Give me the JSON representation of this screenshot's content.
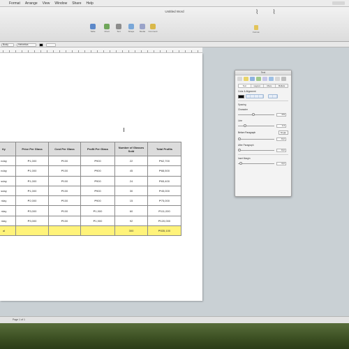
{
  "menubar": {
    "items": [
      "",
      "Format",
      "Arrange",
      "View",
      "Window",
      "Share",
      "Help"
    ]
  },
  "window": {
    "title": "Untitled Word"
  },
  "toolbar": {
    "tools": [
      {
        "label": "Table",
        "icon": "table-icon",
        "color": "#5c88c9"
      },
      {
        "label": "Chart",
        "icon": "chart-icon",
        "color": "#6fa65a"
      },
      {
        "label": "Text",
        "icon": "text-icon",
        "color": "#8c8c8c"
      },
      {
        "label": "Shape",
        "icon": "shape-icon",
        "color": "#7aa7d8"
      },
      {
        "label": "Media",
        "icon": "media-icon",
        "color": "#9aa3c9"
      },
      {
        "label": "Comment",
        "icon": "comment-icon",
        "color": "#d9b84a"
      }
    ],
    "right_tool_label": "Format"
  },
  "formatbar": {
    "style_value": "Body",
    "font_value": "Helvetica"
  },
  "table": {
    "headers": [
      "ity",
      "Price Per Glass",
      "Cost Per Glass",
      "Profit Per Glass",
      "Number of Glasses Sold",
      "Total Profits"
    ],
    "rows": [
      [
        "nday",
        "₱1,000",
        "₱100",
        "₱900",
        "22",
        "₱62,700"
      ],
      [
        "nday",
        "₱1,000",
        "₱100",
        "₱900",
        "45",
        "₱88,500"
      ],
      [
        "sday",
        "₱1,000",
        "₱100",
        "₱900",
        "24",
        "₱65,400"
      ],
      [
        "sday",
        "₱1,000",
        "₱100",
        "₱900",
        "30",
        "₱45,000"
      ],
      [
        "rday",
        "₱2,000",
        "₱100",
        "₱900",
        "15",
        "₱75,000"
      ],
      [
        "rday",
        "₱3,000",
        "₱100",
        "₱1,900",
        "60",
        "₱111,000"
      ],
      [
        "rday",
        "₱3,000",
        "₱100",
        "₱1,900",
        "92",
        "₱120,000"
      ]
    ],
    "total_row": [
      "al",
      "",
      "",
      "",
      "300",
      "₱535,100"
    ],
    "colors": {
      "header_bg": "#dcdcdc",
      "total_bg": "#fff37a"
    }
  },
  "inspector": {
    "title": "Text",
    "tabs": [
      "Text",
      "Layout",
      "More",
      "Bullets"
    ],
    "section_color_alignment": "Color & Alignment",
    "section_spacing": "Spacing",
    "label_character": "Character",
    "label_line": "Line",
    "label_before_paragraph": "Before Paragraph",
    "label_after_paragraph": "After Paragraph",
    "label_inset_margin": "Inset Margin",
    "values": {
      "character": "0%",
      "line": "1.0",
      "before": "0 pt",
      "after": "0 pt",
      "inset": "4 pt"
    },
    "single_button_label": "Single",
    "text_color": "#000000"
  },
  "statusbar": {
    "page_text": "Page 1 of 1"
  }
}
